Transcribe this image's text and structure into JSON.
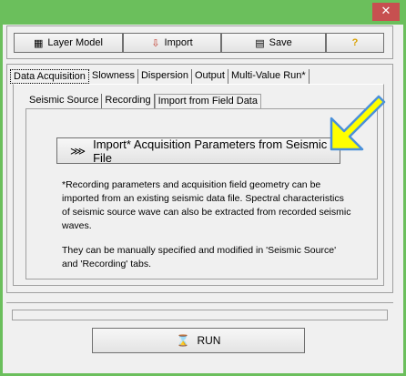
{
  "window": {
    "close_icon": "✕"
  },
  "toolbar": {
    "layer_model_label": "Layer Model",
    "import_label": "Import",
    "save_label": "Save",
    "help_label": "?"
  },
  "tabs_main": [
    {
      "label": "Data Acquisition"
    },
    {
      "label": "Slowness"
    },
    {
      "label": "Dispersion"
    },
    {
      "label": "Output"
    },
    {
      "label": "Multi-Value Run*"
    }
  ],
  "tabs_sub": [
    {
      "label": "Seismic Source"
    },
    {
      "label": "Recording"
    },
    {
      "label": "Import from Field Data"
    }
  ],
  "content": {
    "import_button_label": "Import* Acquisition Parameters from Seismic File",
    "description_1": "*Recording parameters and acquisition field geometry can be imported from an existing seismic data file.  Spectral characteristics of seismic source wave can also be extracted from recorded seismic waves.",
    "description_2": "They can be manually specified and modified in 'Seismic Source' and 'Recording' tabs."
  },
  "run": {
    "label": "RUN"
  },
  "colors": {
    "titlebar": "#6bbf5c",
    "close": "#c75050",
    "arrow_fill": "#ffff00",
    "arrow_stroke": "#4a90d9",
    "help": "#d9a000"
  }
}
